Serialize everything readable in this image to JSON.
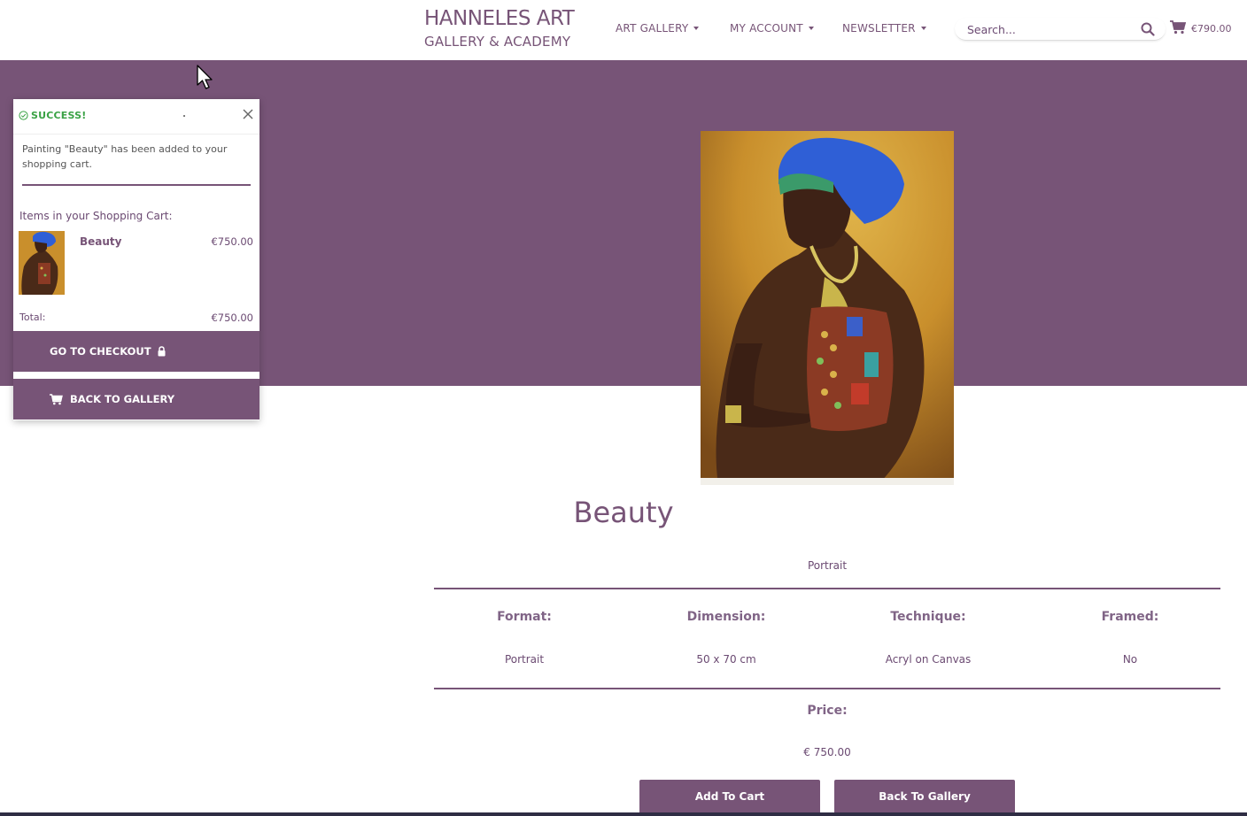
{
  "header": {
    "logo_title": "HANNELES ART",
    "logo_subtitle": "GALLERY & ACADEMY",
    "nav": [
      {
        "label": "ART GALLERY"
      },
      {
        "label": "MY ACCOUNT"
      },
      {
        "label": "NEWSLETTER"
      }
    ],
    "search_placeholder": "Search...",
    "cart_total": "€790.00"
  },
  "product": {
    "title": "Beauty",
    "subtitle": "Portrait",
    "specs": [
      {
        "label": "Format:",
        "value": "Portrait"
      },
      {
        "label": "Dimension:",
        "value": "50 x 70 cm"
      },
      {
        "label": "Technique:",
        "value": "Acryl on Canvas"
      },
      {
        "label": "Framed:",
        "value": "No"
      }
    ],
    "price_label": "Price:",
    "price_value": "€ 750.00",
    "add_to_cart": "Add To Cart",
    "back_to_gallery": "Back To Gallery"
  },
  "popup": {
    "status": "SUCCESS!",
    "message": "Painting \"Beauty\" has been added to your shopping cart.",
    "items_label": "Items in your Shopping Cart:",
    "item_name": "Beauty",
    "item_price": "€750.00",
    "total_label": "Total:",
    "total_value": "€750.00",
    "checkout_label": "GO TO CHECKOUT",
    "back_label": "BACK TO GALLERY"
  },
  "colors": {
    "brand_purple": "#775477",
    "success_green": "#3aa245",
    "footer_navy": "#2f2d44"
  }
}
